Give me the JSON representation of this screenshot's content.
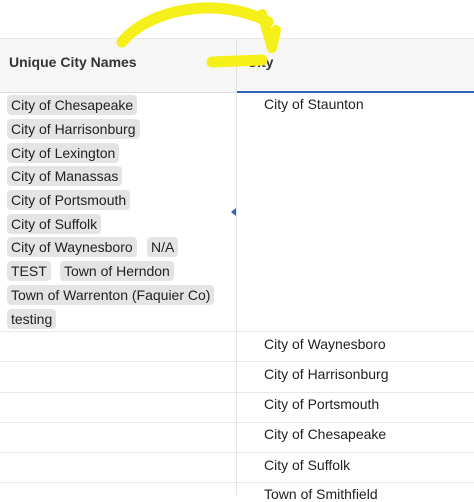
{
  "columns": {
    "unique_city_names": "Unique City Names",
    "city": "City"
  },
  "unique_city_chips": [
    "City of Chesapeake",
    "City of Harrisonburg",
    "City of Lexington",
    "City of Manassas",
    "City of Portsmouth",
    "City of Suffolk",
    "City of Waynesboro",
    "N/A",
    "TEST",
    "Town of Herndon",
    "Town of Warrenton (Faquier Co)",
    "testing"
  ],
  "city_rows": [
    "City of Staunton",
    "City of Waynesboro",
    "City of Harrisonburg",
    "City of Portsmouth",
    "City of Chesapeake",
    "City of Suffolk",
    "Town of Smithfield"
  ],
  "colors": {
    "accent": "#2f64b8",
    "annotation": "#f5ef1a",
    "chip_bg": "#e4e4e4",
    "header_bg": "#f6f6f6"
  },
  "annotation_icon": "hand-drawn-arrow-icon"
}
